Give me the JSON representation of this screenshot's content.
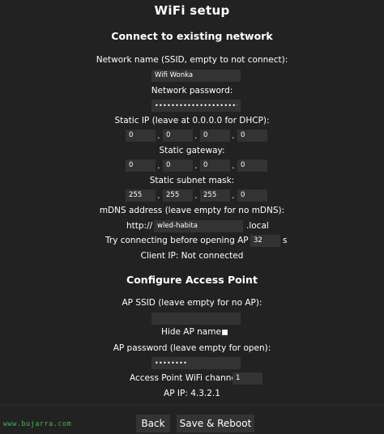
{
  "page": {
    "title": "WiFi setup"
  },
  "connect": {
    "heading": "Connect to existing network",
    "ssid_label": "Network name (SSID, empty to not connect):",
    "ssid_value": "Wifi Wonka",
    "password_label": "Network password:",
    "password_value": "•••••••••••••••••••••••••",
    "static_ip_label": "Static IP (leave at 0.0.0.0 for DHCP):",
    "static_ip": [
      "0",
      "0",
      "0",
      "0"
    ],
    "gateway_label": "Static gateway:",
    "gateway": [
      "0",
      "0",
      "0",
      "0"
    ],
    "subnet_label": "Static subnet mask:",
    "subnet": [
      "255",
      "255",
      "255",
      "0"
    ],
    "ip_separator": ".",
    "mdns_label": "mDNS address (leave empty for no mDNS):",
    "mdns_prefix": "http://",
    "mdns_value": "wled-habita",
    "mdns_suffix": ".local",
    "try_label": "Try connecting before opening AP for:",
    "try_value": "32",
    "try_unit": "s",
    "client_ip": "Client IP: Not connected"
  },
  "ap": {
    "heading": "Configure Access Point",
    "ssid_label": "AP SSID (leave empty for no AP):",
    "ssid_value": "",
    "hide_label": "Hide AP name:",
    "hide_checked": false,
    "password_label": "AP password (leave empty for open):",
    "password_value": "••••••••",
    "channel_label": "Access Point WiFi channel:",
    "channel_value": "1",
    "ap_ip": "AP IP: 4.3.2.1"
  },
  "footer": {
    "back_label": "Back",
    "save_label": "Save & Reboot"
  },
  "watermark": "www.bujarra.com",
  "colors": {
    "background": "#222222",
    "input_background": "#333333",
    "text": "#ffffff",
    "watermark": "#4caf50"
  }
}
